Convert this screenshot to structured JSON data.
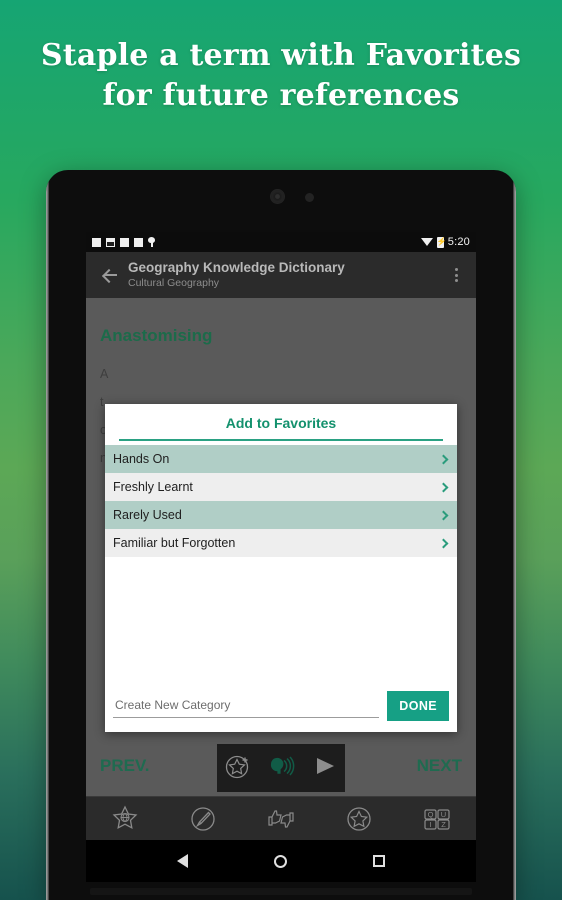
{
  "promo": {
    "headline_line1": "Staple a term with Favorites",
    "headline_line2": "for future references"
  },
  "status_bar": {
    "time": "5:20",
    "icons": [
      "square-icon",
      "image-icon",
      "square-icon",
      "square-icon",
      "pin-icon",
      "wifi-icon",
      "battery-charging-icon"
    ]
  },
  "app_bar": {
    "back_icon": "back-arrow-icon",
    "title": "Geography Knowledge Dictionary",
    "subtitle": "Cultural Geography",
    "overflow_icon": "overflow-menu-icon"
  },
  "entry": {
    "headword": "Anastomising",
    "body_fragment": "A\nt\no\nn"
  },
  "dialog": {
    "title": "Add to Favorites",
    "items": [
      {
        "label": "Hands On",
        "style": "shade",
        "chevron": "chevron-right-icon"
      },
      {
        "label": "Freshly Learnt",
        "style": "plain",
        "chevron": "chevron-right-icon"
      },
      {
        "label": "Rarely Used",
        "style": "shade",
        "chevron": "chevron-right-icon"
      },
      {
        "label": "Familiar but Forgotten",
        "style": "plain",
        "chevron": "chevron-right-icon"
      }
    ],
    "new_category_placeholder": "Create New Category",
    "new_category_value": "",
    "done_label": "DONE"
  },
  "nav_row": {
    "prev_label": "PREV.",
    "next_label": "NEXT",
    "media_icons": [
      "add-to-favorites-star-icon",
      "pronounce-speaker-icon",
      "play-icon"
    ]
  },
  "toolbar": {
    "items": [
      "globe-star-icon",
      "pen-circle-icon",
      "thumbs-rate-icon",
      "star-outline-icon",
      "quiz-blocks-icon"
    ]
  },
  "system_nav": {
    "items": [
      "back-triangle-icon",
      "home-circle-icon",
      "recents-square-icon"
    ]
  },
  "colors": {
    "brand_teal": "#16a085",
    "title_teal": "#13916d",
    "row_shade": "#b0cec6",
    "row_plain": "#eeeeee",
    "headword_green": "#1c6b4a"
  }
}
